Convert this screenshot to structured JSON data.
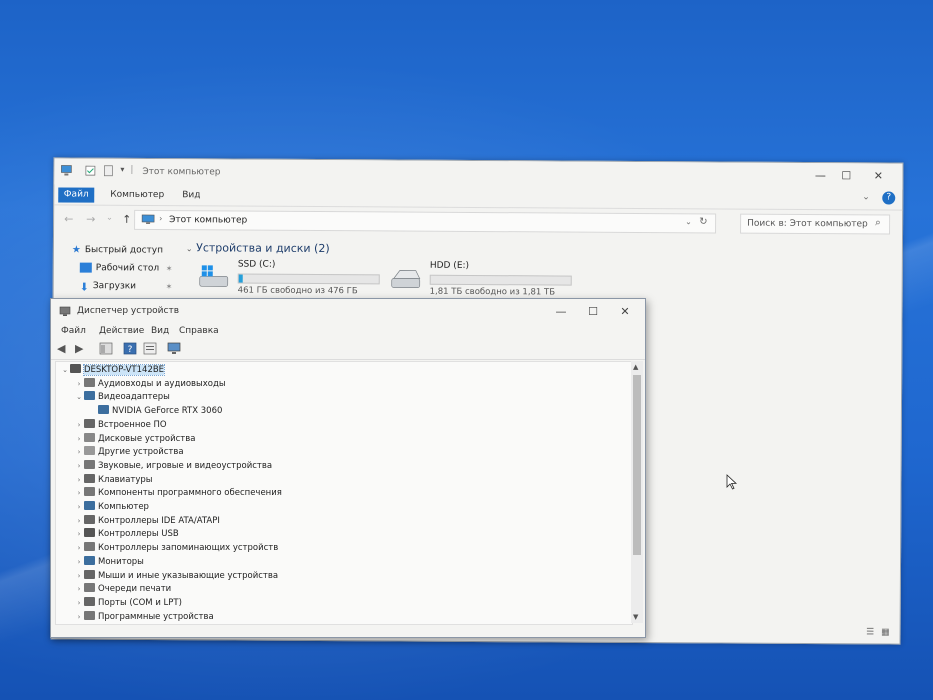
{
  "explorer": {
    "title": "Этот компьютер",
    "ribbon_tabs": [
      "Файл",
      "Компьютер",
      "Вид"
    ],
    "address": "Этот компьютер",
    "search_placeholder": "Поиск в: Этот компьютер",
    "nav_items": [
      {
        "label": "Быстрый доступ",
        "icon": "star-icon"
      },
      {
        "label": "Рабочий стол",
        "icon": "desktop-folder-icon"
      },
      {
        "label": "Загрузки",
        "icon": "download-icon"
      }
    ],
    "group_header": "Устройства и диски (2)",
    "drives": [
      {
        "name": "SSD (C:)",
        "free": "461 ГБ свободно из 476 ГБ",
        "used_fraction": 0.03,
        "icon": "windows-drive-icon"
      },
      {
        "name": "HDD (E:)",
        "free": "1,81 ТБ свободно из 1,81 ТБ",
        "used_fraction": 0.0,
        "icon": "hdd-icon"
      }
    ]
  },
  "devmgr": {
    "title": "Диспетчер устройств",
    "menus": [
      "Файл",
      "Действие",
      "Вид",
      "Справка"
    ],
    "tree": [
      {
        "label": "DESKTOP-VT142BE",
        "level": 0,
        "expander": "expanded",
        "icon": "computer-root-icon",
        "selected": true
      },
      {
        "label": "Аудиовходы и аудиовыходы",
        "level": 1,
        "expander": "collapsed",
        "icon": "audio-io-icon"
      },
      {
        "label": "Видеоадаптеры",
        "level": 1,
        "expander": "expanded",
        "icon": "display-adapter-icon"
      },
      {
        "label": "NVIDIA GeForce RTX 3060",
        "level": 2,
        "expander": "none",
        "icon": "gpu-icon"
      },
      {
        "label": "Встроенное ПО",
        "level": 1,
        "expander": "collapsed",
        "icon": "firmware-icon"
      },
      {
        "label": "Дисковые устройства",
        "level": 1,
        "expander": "collapsed",
        "icon": "disk-drive-icon"
      },
      {
        "label": "Другие устройства",
        "level": 1,
        "expander": "collapsed",
        "icon": "unknown-device-icon"
      },
      {
        "label": "Звуковые, игровые и видеоустройства",
        "level": 1,
        "expander": "collapsed",
        "icon": "speaker-icon"
      },
      {
        "label": "Клавиатуры",
        "level": 1,
        "expander": "collapsed",
        "icon": "keyboard-icon"
      },
      {
        "label": "Компоненты программного обеспечения",
        "level": 1,
        "expander": "collapsed",
        "icon": "software-component-icon"
      },
      {
        "label": "Компьютер",
        "level": 1,
        "expander": "collapsed",
        "icon": "computer-icon"
      },
      {
        "label": "Контроллеры IDE ATA/ATAPI",
        "level": 1,
        "expander": "collapsed",
        "icon": "ide-controller-icon"
      },
      {
        "label": "Контроллеры USB",
        "level": 1,
        "expander": "collapsed",
        "icon": "usb-icon"
      },
      {
        "label": "Контроллеры запоминающих устройств",
        "level": 1,
        "expander": "collapsed",
        "icon": "storage-controller-icon"
      },
      {
        "label": "Мониторы",
        "level": 1,
        "expander": "collapsed",
        "icon": "monitor-icon"
      },
      {
        "label": "Мыши и иные указывающие устройства",
        "level": 1,
        "expander": "collapsed",
        "icon": "mouse-icon"
      },
      {
        "label": "Очереди печати",
        "level": 1,
        "expander": "collapsed",
        "icon": "printer-icon"
      },
      {
        "label": "Порты (COM и LPT)",
        "level": 1,
        "expander": "collapsed",
        "icon": "port-icon"
      },
      {
        "label": "Программные устройства",
        "level": 1,
        "expander": "collapsed",
        "icon": "software-device-icon"
      }
    ]
  },
  "colors": {
    "desktop": "#1f67cf",
    "accent": "#1f6fc5",
    "drive_bar": "#26a0da"
  }
}
